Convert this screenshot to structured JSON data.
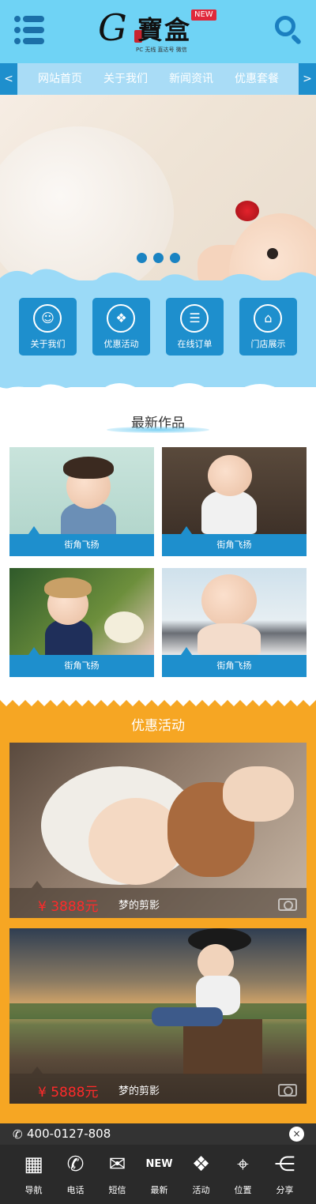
{
  "header": {
    "logo_letter": "G",
    "logo_text": "寶盒",
    "logo_badge": "NEW",
    "logo_tagline": "PC  无线  直达号  微信"
  },
  "nav": {
    "prev": "<",
    "next": ">",
    "items": [
      "网站首页",
      "关于我们",
      "新闻资讯",
      "优惠套餐"
    ]
  },
  "quick_links": [
    {
      "label": "关于我们",
      "icon": "person-icon",
      "glyph": "☺"
    },
    {
      "label": "优惠活动",
      "icon": "gift-icon",
      "glyph": "❖"
    },
    {
      "label": "在线订单",
      "icon": "document-icon",
      "glyph": "☰"
    },
    {
      "label": "门店展示",
      "icon": "store-icon",
      "glyph": "⌂"
    }
  ],
  "latest_works": {
    "title": "最新作品",
    "items": [
      {
        "caption": "街角飞扬"
      },
      {
        "caption": "街角飞扬"
      },
      {
        "caption": "街角飞扬"
      },
      {
        "caption": "街角飞扬"
      }
    ]
  },
  "promotions": {
    "title": "优惠活动",
    "items": [
      {
        "price": "¥ 3888元",
        "name": "梦的剪影"
      },
      {
        "price": "¥ 5888元",
        "name": "梦的剪影"
      }
    ]
  },
  "contact": {
    "phone": "400-0127-808",
    "close": "×"
  },
  "bottom_bar": [
    {
      "label": "导航",
      "icon": "grid-icon",
      "glyph": "▦"
    },
    {
      "label": "电话",
      "icon": "phone-icon",
      "glyph": "✆"
    },
    {
      "label": "短信",
      "icon": "message-icon",
      "glyph": "✉"
    },
    {
      "label": "最新",
      "icon": "new-icon",
      "glyph": "NEW"
    },
    {
      "label": "活动",
      "icon": "gift-icon",
      "glyph": "❖"
    },
    {
      "label": "位置",
      "icon": "location-icon",
      "glyph": "⌖"
    },
    {
      "label": "分享",
      "icon": "share-icon",
      "glyph": "⋲"
    }
  ],
  "colors": {
    "header_bg": "#6fd3f5",
    "brand_blue": "#1e8fcd",
    "promo_bg": "#f6a623",
    "price_red": "#ff2a2a",
    "bottom_bar_bg": "#2a2a2a"
  }
}
